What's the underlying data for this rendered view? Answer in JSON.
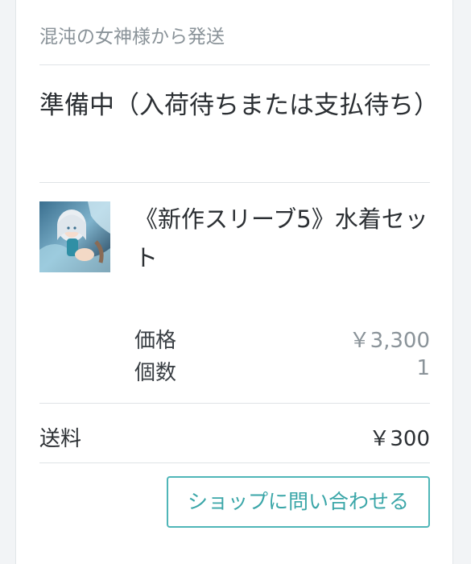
{
  "order": {
    "sender": "混沌の女神様から発送",
    "status": "準備中（入荷待ちまたは支払待ち）"
  },
  "item": {
    "name": "《新作スリーブ5》水着セット",
    "thumbnail_icon": "product-thumbnail-image",
    "price_label": "価格",
    "price_value": "￥3,300",
    "quantity_label": "個数",
    "quantity_value": "1"
  },
  "shipping": {
    "label": "送料",
    "value": "￥300"
  },
  "actions": {
    "contact_label": "ショップに問い合わせる"
  },
  "colors": {
    "accent": "#4fb6b8",
    "muted_text": "#8a9399",
    "divider": "#dfe3e6"
  }
}
